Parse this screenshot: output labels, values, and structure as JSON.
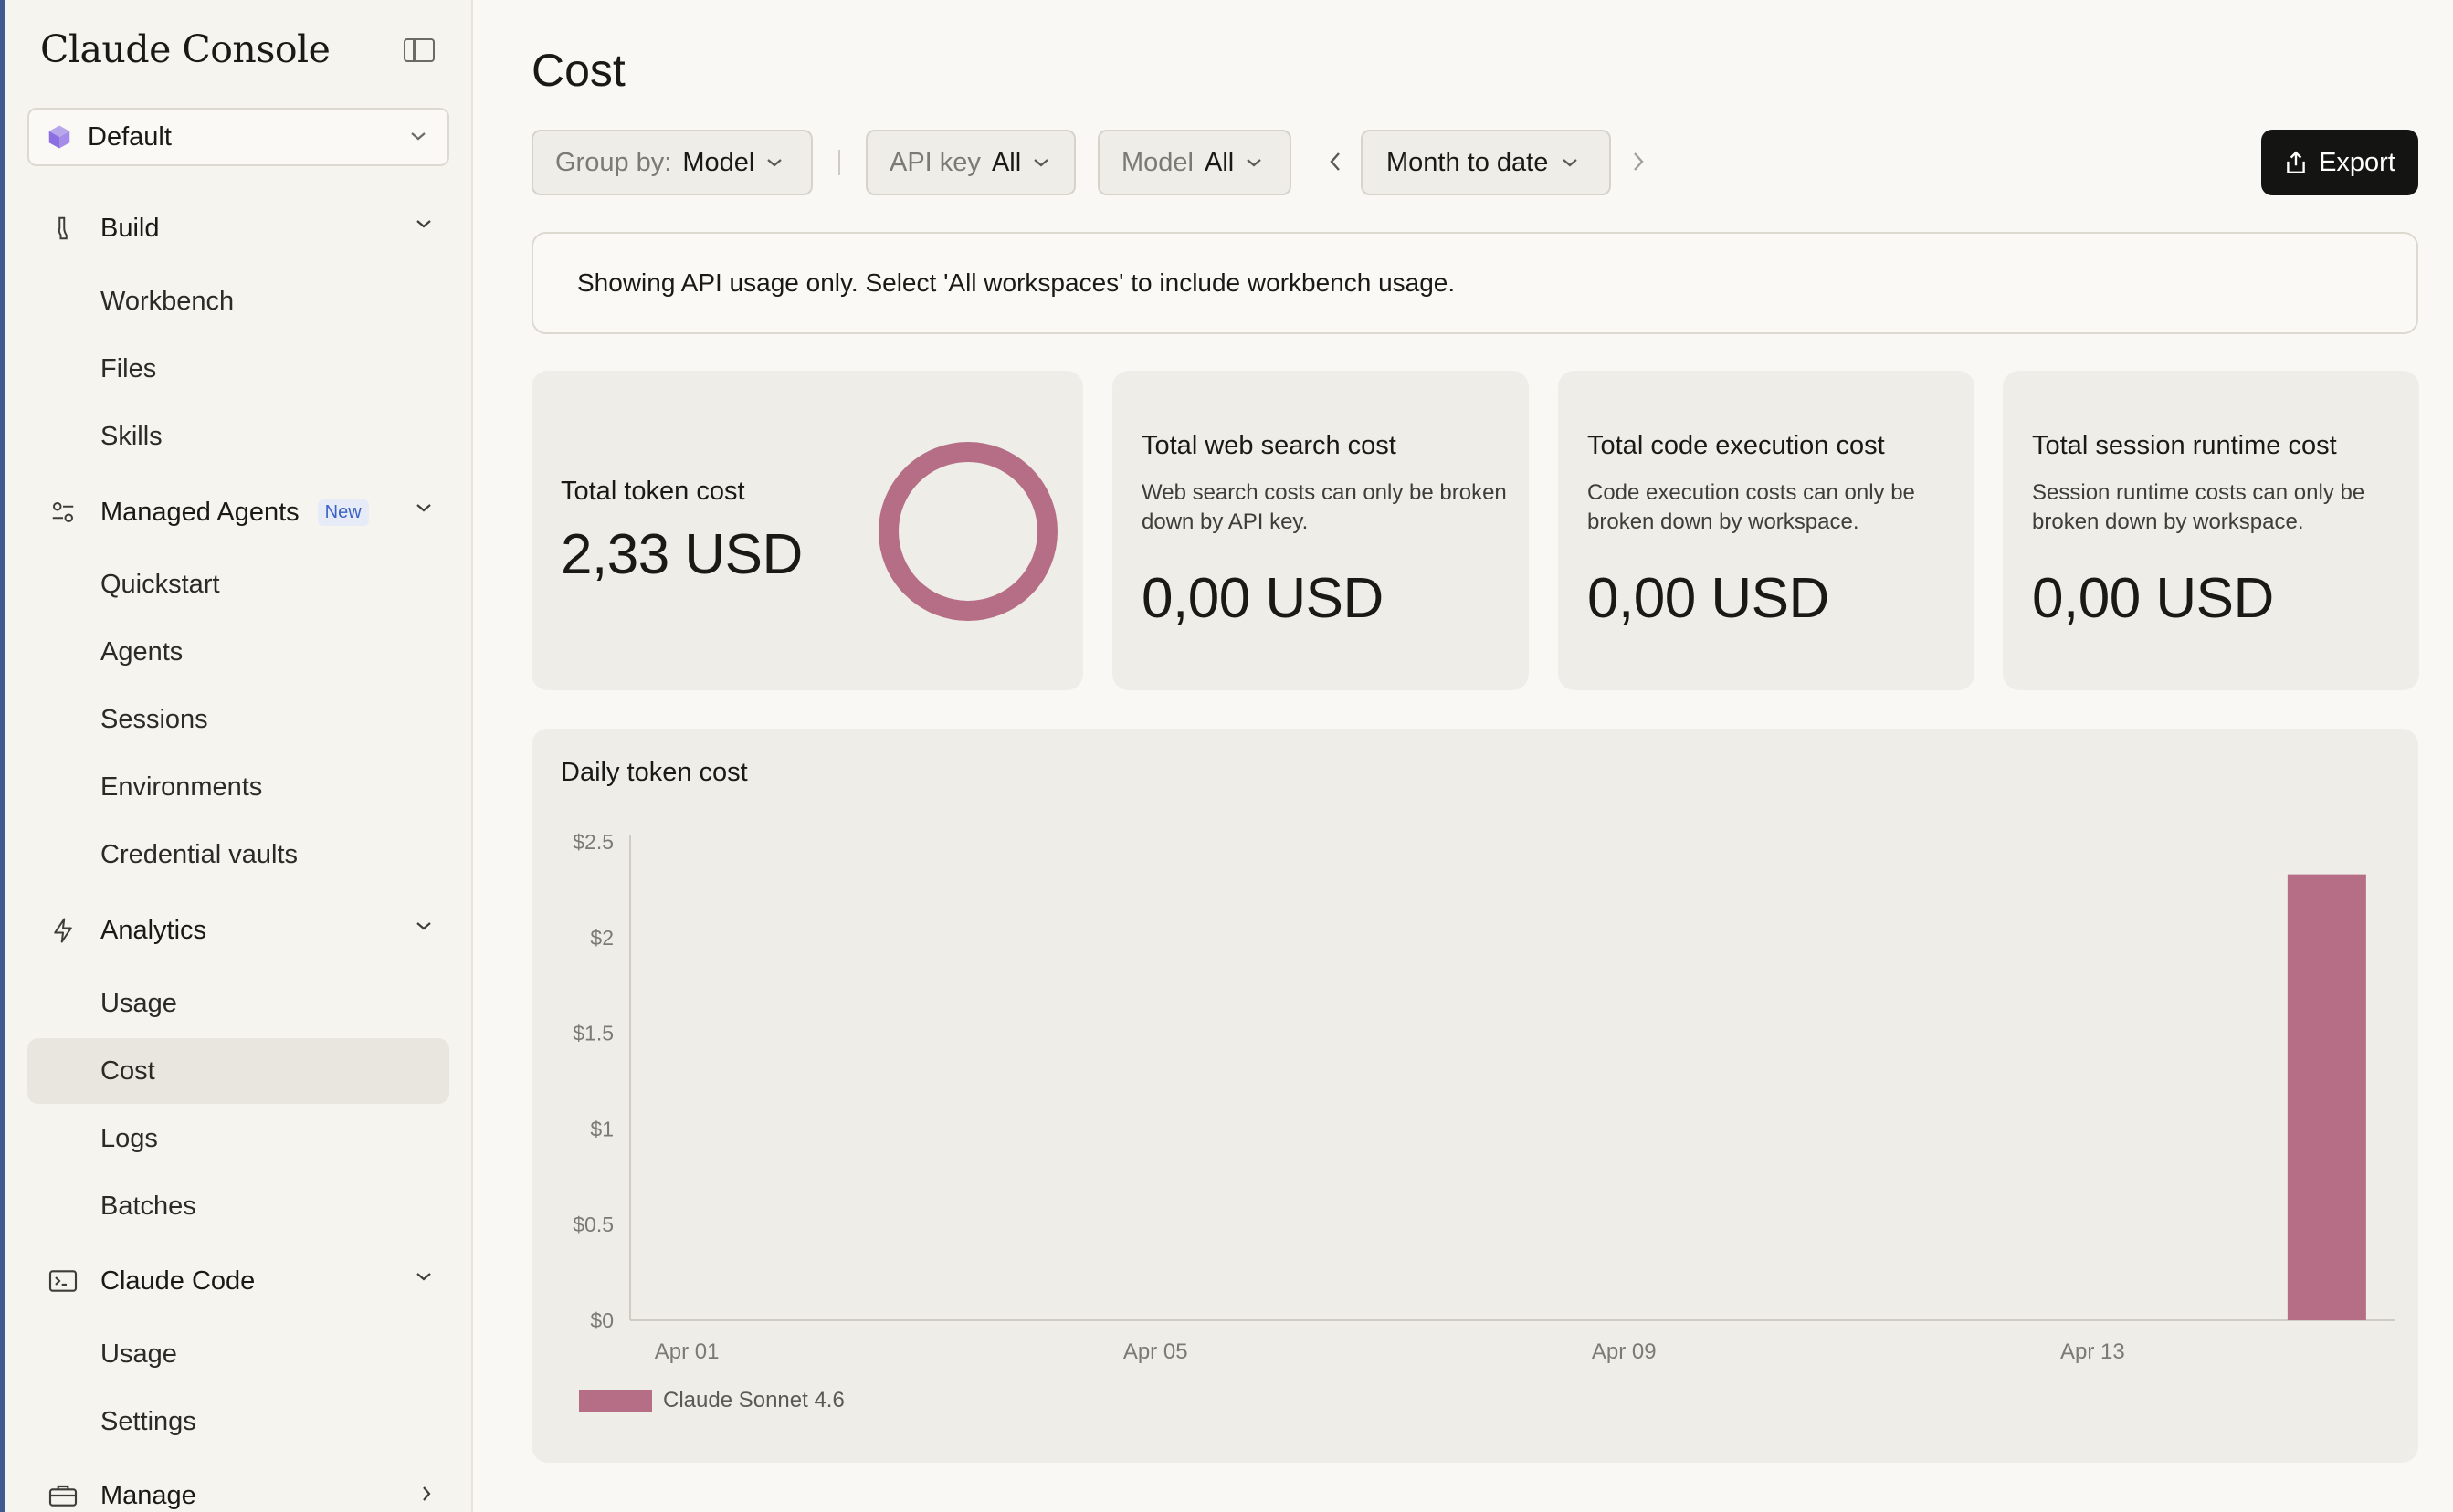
{
  "app": {
    "title": "Claude Console"
  },
  "workspace": {
    "selected": "Default"
  },
  "sidebar": {
    "groups": [
      {
        "label": "Build",
        "items": [
          "Workbench",
          "Files",
          "Skills"
        ]
      },
      {
        "label": "Managed Agents",
        "badge": "New",
        "items": [
          "Quickstart",
          "Agents",
          "Sessions",
          "Environments",
          "Credential vaults"
        ]
      },
      {
        "label": "Analytics",
        "items": [
          "Usage",
          "Cost",
          "Logs",
          "Batches"
        ]
      },
      {
        "label": "Claude Code",
        "items": [
          "Usage",
          "Settings"
        ]
      },
      {
        "label": "Manage",
        "items": []
      }
    ],
    "active_item": "Cost"
  },
  "page": {
    "title": "Cost"
  },
  "filters": {
    "group_by": {
      "key": "Group by:",
      "value": "Model"
    },
    "api_key": {
      "key": "API key",
      "value": "All"
    },
    "model": {
      "key": "Model",
      "value": "All"
    },
    "date_range": "Month to date",
    "export_label": "Export"
  },
  "notice": "Showing API usage only. Select 'All workspaces' to include workbench usage.",
  "cards": {
    "token": {
      "title": "Total token cost",
      "value": "2,33 USD"
    },
    "web_search": {
      "title": "Total web search cost",
      "desc": "Web search costs can only be broken down by API key.",
      "value": "0,00 USD"
    },
    "code_exec": {
      "title": "Total code execution cost",
      "desc": "Code execution costs can only be broken down by workspace.",
      "value": "0,00 USD"
    },
    "session": {
      "title": "Total session runtime cost",
      "desc": "Session runtime costs can only be broken down by workspace.",
      "value": "0,00 USD"
    }
  },
  "colors": {
    "accent": "#b56e86",
    "primary_button": "#141413"
  },
  "chart_data": {
    "type": "bar",
    "title": "Daily token cost",
    "xlabel": "",
    "ylabel": "",
    "ylim": [
      0,
      2.5
    ],
    "yticks": [
      "$0",
      "$0.5",
      "$1",
      "$1.5",
      "$2",
      "$2.5"
    ],
    "ytick_values": [
      0,
      0.5,
      1,
      1.5,
      2,
      2.5
    ],
    "xticks": [
      "Apr 01",
      "Apr 05",
      "Apr 09",
      "Apr 13"
    ],
    "categories": [
      "Apr 01",
      "Apr 02",
      "Apr 03",
      "Apr 04",
      "Apr 05",
      "Apr 06",
      "Apr 07",
      "Apr 08",
      "Apr 09",
      "Apr 10",
      "Apr 11",
      "Apr 12",
      "Apr 13",
      "Apr 14",
      "Apr 15"
    ],
    "series": [
      {
        "name": "Claude Sonnet 4.6",
        "color": "#b56e86",
        "values": [
          0,
          0,
          0,
          0,
          0,
          0,
          0,
          0,
          0,
          0,
          0,
          0,
          0,
          0,
          2.33
        ]
      }
    ],
    "grid": false,
    "legend": "bottom-left"
  }
}
